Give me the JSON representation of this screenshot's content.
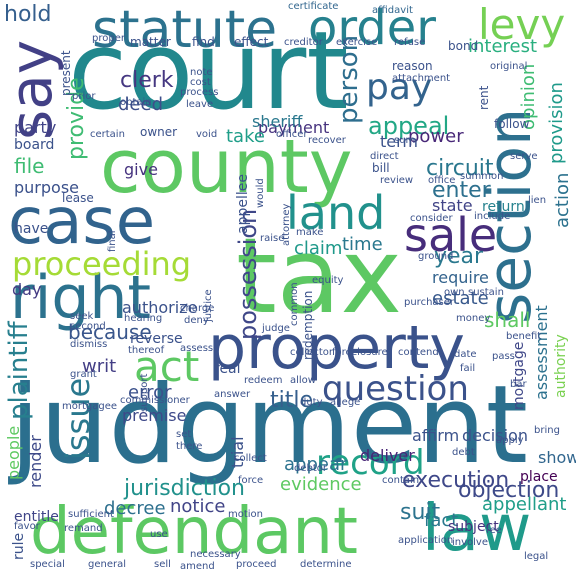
{
  "words": [
    {
      "text": "court",
      "color": "#21888d"
    },
    {
      "text": "judgment",
      "color": "#2b6f8e"
    },
    {
      "text": "tax",
      "color": "#5dc863"
    },
    {
      "text": "county",
      "color": "#5dc863"
    },
    {
      "text": "case",
      "color": "#31638d"
    },
    {
      "text": "property",
      "color": "#3a528b"
    },
    {
      "text": "defendant",
      "color": "#5cc863"
    },
    {
      "text": "law",
      "color": "#1f9a8a"
    },
    {
      "text": "right",
      "color": "#2c728e"
    },
    {
      "text": "section",
      "color": "#2d708e"
    },
    {
      "text": "statute",
      "color": "#2c728e"
    },
    {
      "text": "order",
      "color": "#26818e"
    },
    {
      "text": "say",
      "color": "#424086"
    },
    {
      "text": "land",
      "color": "#21918c"
    },
    {
      "text": "sale",
      "color": "#472d7b"
    },
    {
      "text": "levy",
      "color": "#75d054"
    },
    {
      "text": "proceeding",
      "color": "#a5db36"
    },
    {
      "text": "act",
      "color": "#5dc863"
    },
    {
      "text": "record",
      "color": "#1fa287"
    },
    {
      "text": "question",
      "color": "#3b528b"
    },
    {
      "text": "pay",
      "color": "#33638d"
    },
    {
      "text": "plaintiff",
      "color": "#277f8e"
    },
    {
      "text": "issue",
      "color": "#2a788e"
    },
    {
      "text": "appeal",
      "color": "#22a785"
    },
    {
      "text": "person",
      "color": "#2e6e8e"
    },
    {
      "text": "execution",
      "color": "#3f4889"
    },
    {
      "text": "jurisdiction",
      "color": "#21918c"
    },
    {
      "text": "objection",
      "color": "#3e4a89"
    },
    {
      "text": "possession",
      "color": "#3f4788"
    },
    {
      "text": "title",
      "color": "#355f8d"
    },
    {
      "text": "suit",
      "color": "#2c738e"
    },
    {
      "text": "appellant",
      "color": "#1f9e89"
    },
    {
      "text": "circuit",
      "color": "#2a778e"
    },
    {
      "text": "enter",
      "color": "#2d708e"
    },
    {
      "text": "state",
      "color": "#414487"
    },
    {
      "text": "land",
      "color": "#21918c"
    },
    {
      "text": "deed",
      "color": "#3d4e8a"
    },
    {
      "text": "clerk",
      "color": "#453781"
    },
    {
      "text": "hold",
      "color": "#355f8d"
    },
    {
      "text": "interest",
      "color": "#29af7f"
    },
    {
      "text": "provision",
      "color": "#1f9a8a"
    },
    {
      "text": "action",
      "color": "#2c728e"
    },
    {
      "text": "opinion",
      "color": "#3fbc73"
    },
    {
      "text": "return",
      "color": "#26828e"
    },
    {
      "text": "require",
      "color": "#33638d"
    },
    {
      "text": "year",
      "color": "#2a788e"
    },
    {
      "text": "shall",
      "color": "#5ec962"
    },
    {
      "text": "estate",
      "color": "#38598c"
    },
    {
      "text": "time",
      "color": "#2a788e"
    },
    {
      "text": "claim",
      "color": "#1f998a"
    },
    {
      "text": "because",
      "color": "#39568c"
    },
    {
      "text": "writ",
      "color": "#433e85"
    },
    {
      "text": "error",
      "color": "#3b518b"
    },
    {
      "text": "day",
      "color": "#443a83"
    },
    {
      "text": "premise",
      "color": "#3e4989"
    },
    {
      "text": "decree",
      "color": "#2d708e"
    },
    {
      "text": "appear",
      "color": "#2c728e"
    },
    {
      "text": "evidence",
      "color": "#5ec962"
    },
    {
      "text": "fact",
      "color": "#2a788e"
    },
    {
      "text": "notice",
      "color": "#414487"
    },
    {
      "text": "file",
      "color": "#3fbc73"
    },
    {
      "text": "give",
      "color": "#46337f"
    },
    {
      "text": "purpose",
      "color": "#3b518b"
    },
    {
      "text": "provide",
      "color": "#3fbc73"
    },
    {
      "text": "party",
      "color": "#414487"
    },
    {
      "text": "payment",
      "color": "#46327e"
    },
    {
      "text": "take",
      "color": "#1f9e89"
    },
    {
      "text": "power",
      "color": "#482878"
    },
    {
      "text": "sheriff",
      "color": "#2a788e"
    },
    {
      "text": "assessment",
      "color": "#2c718e"
    },
    {
      "text": "affirm",
      "color": "#3b528b"
    },
    {
      "text": "decision",
      "color": "#3b528b"
    },
    {
      "text": "trial",
      "color": "#3b528b"
    },
    {
      "text": "people",
      "color": "#5ec962"
    },
    {
      "text": "render",
      "color": "#3e4a89"
    },
    {
      "text": "entitle",
      "color": "#404588"
    },
    {
      "text": "mortgage",
      "color": "#3f4788"
    },
    {
      "text": "authority",
      "color": "#7ad151"
    },
    {
      "text": "subject",
      "color": "#46337f"
    },
    {
      "text": "deliver",
      "color": "#482576"
    },
    {
      "text": "show",
      "color": "#31668e"
    },
    {
      "text": "place",
      "color": "#440154"
    },
    {
      "text": "term",
      "color": "#3b528b"
    },
    {
      "text": "authorize",
      "color": "#3b528b"
    },
    {
      "text": "have",
      "color": "#3b528b"
    },
    {
      "text": "reverse",
      "color": "#3b528b"
    },
    {
      "text": "board",
      "color": "#3b528b"
    },
    {
      "text": "real",
      "color": "#3b528b"
    },
    {
      "text": "rule",
      "color": "#3b528b"
    },
    {
      "text": "statute",
      "color": "#2c728e"
    },
    {
      "text": "levy",
      "color": "#75d054"
    },
    {
      "text": "certificate",
      "color": "#31668e"
    },
    {
      "text": "affidavit",
      "color": "#31668e"
    },
    {
      "text": "bond",
      "color": "#3b528b"
    },
    {
      "text": "matter",
      "color": "#3b528b"
    },
    {
      "text": "find",
      "color": "#3b528b"
    },
    {
      "text": "effect",
      "color": "#3b528b"
    },
    {
      "text": "exercise",
      "color": "#3b528b"
    },
    {
      "text": "refuse",
      "color": "#3b528b"
    },
    {
      "text": "creditor",
      "color": "#3b528b"
    },
    {
      "text": "present",
      "color": "#3b528b"
    },
    {
      "text": "prior",
      "color": "#3b528b"
    },
    {
      "text": "proper",
      "color": "#3b528b"
    },
    {
      "text": "note",
      "color": "#3b528b"
    },
    {
      "text": "cost",
      "color": "#3b528b"
    },
    {
      "text": "process",
      "color": "#3b528b"
    },
    {
      "text": "obtain",
      "color": "#3b528b"
    },
    {
      "text": "leave",
      "color": "#3b528b"
    },
    {
      "text": "reason",
      "color": "#3b528b"
    },
    {
      "text": "attachment",
      "color": "#3b528b"
    },
    {
      "text": "rent",
      "color": "#3b528b"
    },
    {
      "text": "original",
      "color": "#3b528b"
    },
    {
      "text": "follow",
      "color": "#3b528b"
    },
    {
      "text": "owner",
      "color": "#3b528b"
    },
    {
      "text": "void",
      "color": "#3b528b"
    },
    {
      "text": "officer",
      "color": "#3b528b"
    },
    {
      "text": "certain",
      "color": "#3b528b"
    },
    {
      "text": "direct",
      "color": "#3b528b"
    },
    {
      "text": "recover",
      "color": "#3b528b"
    },
    {
      "text": "sum",
      "color": "#3b528b"
    },
    {
      "text": "bill",
      "color": "#3b528b"
    },
    {
      "text": "review",
      "color": "#3b528b"
    },
    {
      "text": "summon",
      "color": "#3b528b"
    },
    {
      "text": "office",
      "color": "#3b528b"
    },
    {
      "text": "serve",
      "color": "#3b528b"
    },
    {
      "text": "lien",
      "color": "#3b528b"
    },
    {
      "text": "include",
      "color": "#3b528b"
    },
    {
      "text": "consider",
      "color": "#3b528b"
    },
    {
      "text": "lease",
      "color": "#3b528b"
    },
    {
      "text": "appellee",
      "color": "#3b528b"
    },
    {
      "text": "would",
      "color": "#3b528b"
    },
    {
      "text": "attorney",
      "color": "#3b528b"
    },
    {
      "text": "make",
      "color": "#3b528b"
    },
    {
      "text": "raise",
      "color": "#3b528b"
    },
    {
      "text": "ground",
      "color": "#3b528b"
    },
    {
      "text": "equity",
      "color": "#3b528b"
    },
    {
      "text": "final",
      "color": "#3b528b"
    },
    {
      "text": "hearing",
      "color": "#3b528b"
    },
    {
      "text": "charge",
      "color": "#3b528b"
    },
    {
      "text": "deny",
      "color": "#3b528b"
    },
    {
      "text": "judge",
      "color": "#3b528b"
    },
    {
      "text": "common",
      "color": "#3b528b"
    },
    {
      "text": "redemption",
      "color": "#3b528b"
    },
    {
      "text": "purchaser",
      "color": "#3b528b"
    },
    {
      "text": "own",
      "color": "#3b528b"
    },
    {
      "text": "sustain",
      "color": "#3b528b"
    },
    {
      "text": "seek",
      "color": "#3b528b"
    },
    {
      "text": "second",
      "color": "#3b528b"
    },
    {
      "text": "justice",
      "color": "#3b528b"
    },
    {
      "text": "collector",
      "color": "#3b528b"
    },
    {
      "text": "foreclosure",
      "color": "#3b528b"
    },
    {
      "text": "contend",
      "color": "#3b528b"
    },
    {
      "text": "money",
      "color": "#3b528b"
    },
    {
      "text": "benefit",
      "color": "#3b528b"
    },
    {
      "text": "dismiss",
      "color": "#3b528b"
    },
    {
      "text": "thereof",
      "color": "#3b528b"
    },
    {
      "text": "assess",
      "color": "#3b528b"
    },
    {
      "text": "date",
      "color": "#3b528b"
    },
    {
      "text": "pass",
      "color": "#3b528b"
    },
    {
      "text": "grant",
      "color": "#3b528b"
    },
    {
      "text": "redeem",
      "color": "#3b528b"
    },
    {
      "text": "allow",
      "color": "#3b528b"
    },
    {
      "text": "fail",
      "color": "#3b528b"
    },
    {
      "text": "commissioner",
      "color": "#3b528b"
    },
    {
      "text": "answer",
      "color": "#3b528b"
    },
    {
      "text": "duty",
      "color": "#3b528b"
    },
    {
      "text": "allege",
      "color": "#3b528b"
    },
    {
      "text": "bar",
      "color": "#3b528b"
    },
    {
      "text": "support",
      "color": "#3b528b"
    },
    {
      "text": "set",
      "color": "#3b528b"
    },
    {
      "text": "there",
      "color": "#3b528b"
    },
    {
      "text": "collect",
      "color": "#3b528b"
    },
    {
      "text": "debt",
      "color": "#3b528b"
    },
    {
      "text": "apply",
      "color": "#3b528b"
    },
    {
      "text": "bring",
      "color": "#3b528b"
    },
    {
      "text": "force",
      "color": "#3b528b"
    },
    {
      "text": "debtor",
      "color": "#3b528b"
    },
    {
      "text": "contain",
      "color": "#3b528b"
    },
    {
      "text": "favor",
      "color": "#3b528b"
    },
    {
      "text": "sufficient",
      "color": "#3b528b"
    },
    {
      "text": "motion",
      "color": "#3b528b"
    },
    {
      "text": "involve",
      "color": "#3b528b"
    },
    {
      "text": "fee",
      "color": "#3b528b"
    },
    {
      "text": "legal",
      "color": "#3b528b"
    },
    {
      "text": "remand",
      "color": "#3b528b"
    },
    {
      "text": "use",
      "color": "#3b528b"
    },
    {
      "text": "necessary",
      "color": "#3b528b"
    },
    {
      "text": "application",
      "color": "#3b528b"
    },
    {
      "text": "special",
      "color": "#3b528b"
    },
    {
      "text": "general",
      "color": "#3b528b"
    },
    {
      "text": "sell",
      "color": "#3b528b"
    },
    {
      "text": "amend",
      "color": "#3b528b"
    },
    {
      "text": "proceed",
      "color": "#3b528b"
    },
    {
      "text": "determine",
      "color": "#3b528b"
    },
    {
      "text": "mortgagee",
      "color": "#3b528b"
    }
  ]
}
